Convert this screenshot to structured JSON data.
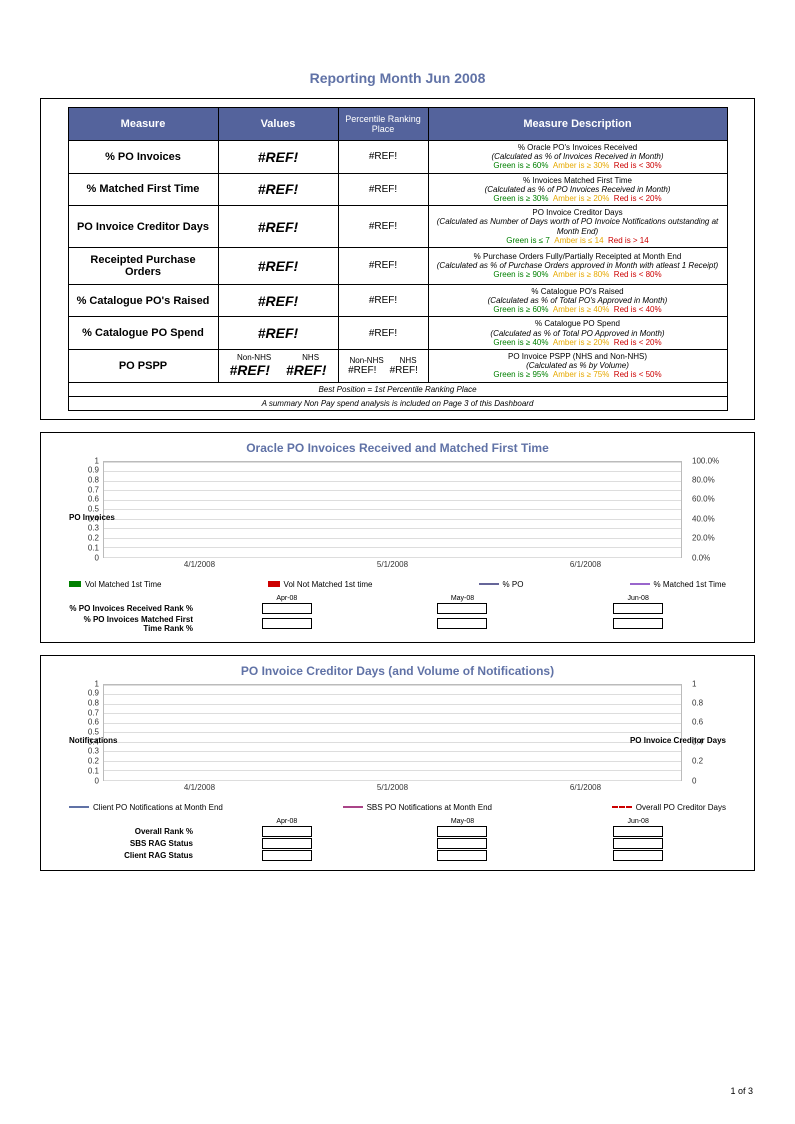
{
  "title": "Reporting Month Jun 2008",
  "headers": {
    "measure": "Measure",
    "values": "Values",
    "percentile": "Percentile Ranking Place",
    "desc": "Measure Description"
  },
  "rows": [
    {
      "name": "% PO Invoices",
      "val": "#REF!",
      "pct": "#REF!",
      "desc1": "% Oracle PO's Invoices Received",
      "desc2": "(Calculated as % of Invoices Received in Month)",
      "rag": {
        "g": "Green is ≥ 60%",
        "a": "Amber is ≥ 30%",
        "r": "Red is < 30%"
      }
    },
    {
      "name": "% Matched First Time",
      "val": "#REF!",
      "pct": "#REF!",
      "desc1": "% Invoices Matched First Time",
      "desc2": "(Calculated as % of PO Invoices Received in Month)",
      "rag": {
        "g": "Green is ≥ 30%",
        "a": "Amber is ≥ 20%",
        "r": "Red is < 20%"
      }
    },
    {
      "name": "PO Invoice Creditor Days",
      "val": "#REF!",
      "pct": "#REF!",
      "desc1": "PO Invoice Creditor Days",
      "desc2": "(Calculated as Number of Days worth of PO Invoice Notifications outstanding at Month End)",
      "rag": {
        "g": "Green is ≤ 7",
        "a": "Amber is ≤ 14",
        "r": "Red is > 14"
      }
    },
    {
      "name": "Receipted Purchase Orders",
      "val": "#REF!",
      "pct": "#REF!",
      "desc1": "% Purchase Orders Fully/Partially Receipted at Month End",
      "desc2": "(Calculated as % of Purchase Orders approved in Month with atleast 1 Receipt)",
      "rag": {
        "g": "Green is ≥ 90%",
        "a": "Amber is ≥ 80%",
        "r": "Red is < 80%"
      }
    },
    {
      "name": "% Catalogue PO's Raised",
      "val": "#REF!",
      "pct": "#REF!",
      "desc1": "% Catalogue PO's Raised",
      "desc2": "(Calculated as % of Total PO's Approved in Month)",
      "rag": {
        "g": "Green is ≥ 60%",
        "a": "Amber is ≥ 40%",
        "r": "Red is < 40%"
      }
    },
    {
      "name": "% Catalogue PO Spend",
      "val": "#REF!",
      "pct": "#REF!",
      "desc1": "% Catalogue PO Spend",
      "desc2": "(Calculated as % of Total PO Approved in Month)",
      "rag": {
        "g": "Green is ≥ 40%",
        "a": "Amber is ≥ 20%",
        "r": "Red is < 20%"
      }
    }
  ],
  "pspp": {
    "name": "PO PSPP",
    "lbl1": "Non-NHS",
    "lbl2": "NHS",
    "v1": "#REF!",
    "v2": "#REF!",
    "p1": "#REF!",
    "p2": "#REF!",
    "desc1": "PO Invoice PSPP (NHS and Non-NHS)",
    "desc2": "(Calculated as % by Volume)",
    "rag": {
      "g": "Green is ≥ 95%",
      "a": "Amber is ≥ 75%",
      "r": "Red is < 50%"
    }
  },
  "foot1": "Best Position = 1st Percentile Ranking Place",
  "foot2": "A summary Non Pay spend analysis is included on Page 3 of this Dashboard",
  "chart1": {
    "title": "Oracle PO Invoices Received and Matched First Time",
    "yLeftLabel": "PO Invoices",
    "yLeft": [
      "1",
      "0.9",
      "0.8",
      "0.7",
      "0.6",
      "0.5",
      "0.4",
      "0.3",
      "0.2",
      "0.1",
      "0"
    ],
    "yRight": [
      "100.0%",
      "80.0%",
      "60.0%",
      "40.0%",
      "20.0%",
      "0.0%"
    ],
    "x": [
      "4/1/2008",
      "5/1/2008",
      "6/1/2008"
    ],
    "legend": [
      {
        "name": "Vol Matched 1st Time",
        "color": "#008000",
        "type": "bar"
      },
      {
        "name": "Vol Not Matched 1st time",
        "color": "#cc0000",
        "type": "bar"
      },
      {
        "name": "% PO",
        "color": "#666699",
        "type": "line"
      },
      {
        "name": "% Matched 1st Time",
        "color": "#9966cc",
        "type": "line"
      }
    ],
    "miniHead": [
      "Apr-08",
      "May-08",
      "Jun-08"
    ],
    "miniRows": [
      "% PO Invoices Received Rank %",
      "% PO Invoices Matched First Time Rank %"
    ]
  },
  "chart2": {
    "title": "PO Invoice Creditor Days (and Volume of Notifications)",
    "yLeftLabel": "Notifications",
    "yRightLabel": "PO Invoice Creditor Days",
    "yLeft": [
      "1",
      "0.9",
      "0.8",
      "0.7",
      "0.6",
      "0.5",
      "0.4",
      "0.3",
      "0.2",
      "0.1",
      "0"
    ],
    "yRight": [
      "1",
      "0.8",
      "0.6",
      "0.4",
      "0.2",
      "0"
    ],
    "x": [
      "4/1/2008",
      "5/1/2008",
      "6/1/2008"
    ],
    "legend": [
      {
        "name": "Client PO Notifications at Month End",
        "color": "#6072a6",
        "type": "line"
      },
      {
        "name": "SBS PO Notifications at Month End",
        "color": "#aa4488",
        "type": "line"
      },
      {
        "name": "Overall PO Creditor Days",
        "color": "#cc0000",
        "type": "dash"
      }
    ],
    "miniHead": [
      "Apr-08",
      "May-08",
      "Jun-08"
    ],
    "miniRows": [
      "Overall Rank %",
      "SBS RAG Status",
      "Client RAG Status"
    ]
  },
  "chart_data": [
    {
      "type": "bar",
      "title": "Oracle PO Invoices Received and Matched First Time",
      "x": [
        "4/1/2008",
        "5/1/2008",
        "6/1/2008"
      ],
      "series": [
        {
          "name": "Vol Matched 1st Time",
          "values": [
            null,
            null,
            null
          ]
        },
        {
          "name": "Vol Not Matched 1st time",
          "values": [
            null,
            null,
            null
          ]
        },
        {
          "name": "% PO",
          "values": [
            null,
            null,
            null
          ]
        },
        {
          "name": "% Matched 1st Time",
          "values": [
            null,
            null,
            null
          ]
        }
      ],
      "ylim_left": [
        0,
        1
      ],
      "ylim_right": [
        0,
        100
      ],
      "ylabel_left": "PO Invoices",
      "ylabel_right": "%"
    },
    {
      "type": "line",
      "title": "PO Invoice Creditor Days (and Volume of Notifications)",
      "x": [
        "4/1/2008",
        "5/1/2008",
        "6/1/2008"
      ],
      "series": [
        {
          "name": "Client PO Notifications at Month End",
          "values": [
            null,
            null,
            null
          ]
        },
        {
          "name": "SBS PO Notifications at Month End",
          "values": [
            null,
            null,
            null
          ]
        },
        {
          "name": "Overall PO Creditor Days",
          "values": [
            null,
            null,
            null
          ]
        }
      ],
      "ylim_left": [
        0,
        1
      ],
      "ylim_right": [
        0,
        1
      ],
      "ylabel_left": "Notifications",
      "ylabel_right": "PO Invoice Creditor Days"
    }
  ],
  "pageNum": "1 of 3"
}
